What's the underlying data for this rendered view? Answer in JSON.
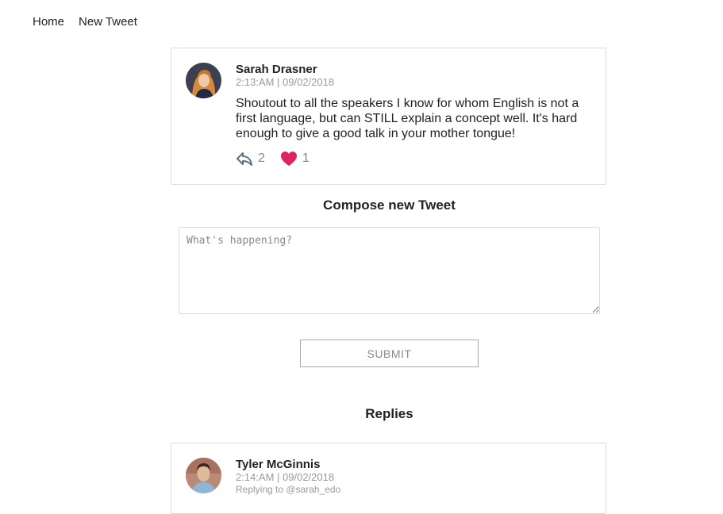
{
  "nav": {
    "items": [
      {
        "label": "Home"
      },
      {
        "label": "New Tweet"
      }
    ]
  },
  "tweet": {
    "author": "Sarah Drasner",
    "timestamp": "2:13:AM | 09/02/2018",
    "text": "Shoutout to all the speakers I know for whom English is not a first language, but can STILL explain a concept well. It's hard enough to give a good talk in your mother tongue!",
    "reply_count": "2",
    "like_count": "1",
    "like_color": "#e0245e",
    "icon_color": "#5b7083"
  },
  "compose": {
    "title": "Compose new Tweet",
    "placeholder": "What's happening?",
    "value": "",
    "submit_label": "SUBMIT"
  },
  "replies": {
    "title": "Replies",
    "items": [
      {
        "author": "Tyler McGinnis",
        "timestamp": "2:14:AM | 09/02/2018",
        "replying_to": "Replying to @sarah_edo"
      }
    ]
  }
}
